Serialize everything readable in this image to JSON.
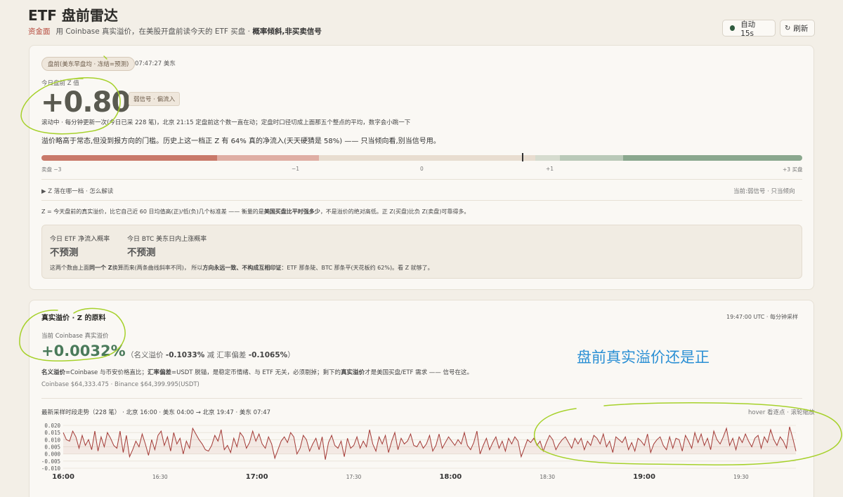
{
  "header": {
    "title": "ETF 盘前雷达",
    "tag": "资金面",
    "subtitle": "用 Coinbase 真实溢价，在美股开盘前读今天的 ETF 买盘 ·",
    "subtitle_bold": "概率倾斜,非买卖信号",
    "auto_label": "自动 15s",
    "refresh_label": "刷新"
  },
  "zcard": {
    "pill": "盘前(美东早盘均 · 冻结=预测)",
    "time": "07:47:27 美东",
    "label": "今日盘前 Z 值",
    "z_value": "+0.80",
    "signal": "弱信号 · 偏流入",
    "rolling_note": "滚动中 · 每分钟更新一次(今日已采 228 笔)，北京 21:15 定盘前这个数一直在动；定盘时口径切成上面那五个整点的平均，数字会小跳一下",
    "description": "溢价略高于常态,但没到报方向的门槛。历史上这一档正 Z 有 64% 真的净流入(天天硬猜是 58%) —— 只当倾向看,别当信号用。",
    "scale_ticks": [
      "卖盘 −3",
      "−1",
      "0",
      "+1",
      "+3 买盘"
    ],
    "marker_value": 0.8,
    "toggle_label": "▶  Z 落在哪一档 · 怎么解读",
    "current_label": "当前:弱信号 · 只当倾向",
    "explain_pre": "Z = 今天盘前的真实溢价，比它自己近 60 日均值高(正)/低(负)几个标准差 —— 衡量的是",
    "explain_bold": "美国买盘比平时强多少",
    "explain_post": "，不是溢价的绝对高低。正 Z(买盘)比负 Z(卖盘)可靠得多。",
    "etf_prob_label": "今日 ETF 净流入概率",
    "etf_prob_value": "不预测",
    "btc_prob_label": "今日 BTC 美东日内上涨概率",
    "btc_prob_value": "不预测",
    "prob_note_1": "这两个数由上面",
    "prob_note_b1": "同一个 Z",
    "prob_note_2": "换算而来(两条曲线斜率不同)， 所以",
    "prob_note_b2": "方向永远一致、不构成互相印证",
    "prob_note_3": "：ETF 那条陡、BTC 那条平(天花板约 62%)。看 Z 就够了。"
  },
  "premium": {
    "title": "真实溢价 · Z 的原料",
    "sample_time": "19:47:00 UTC · 每分钟采样",
    "current_label": "当前 Coinbase 真实溢价",
    "value": "+0.0032%",
    "nominal_pre": "（名义溢价",
    "nominal_value": "-0.1033%",
    "fx_pre": "减 汇率偏差",
    "fx_value": "-0.1065%",
    "close": "）",
    "def_b1": "名义溢价",
    "def_1": "=Coinbase 与币安价格直比；",
    "def_b2": "汇率偏差",
    "def_2": "=USDT 脱锚，是稳定币情绪、与 ETF 无关，必须剔掉；剩下的",
    "def_b3": "真实溢价",
    "def_3": "才是美国买盘/ETF 需求 —— 信号在这。",
    "prices": "Coinbase $64,333.475 · Binance $64,399.995(USDT)",
    "chart_title": "最新采样时段走势（228 笔） · 北京 16:00 · 美东 04:00 → 北京 19:47 · 美东 07:47",
    "chart_hint": "hover 看逐点 · 滚轮缩放"
  },
  "annotation": "盘前真实溢价还是正",
  "colors": {
    "sell": "#c9796a",
    "buy": "#8aa88e",
    "line": "#a33a36",
    "premium": "#4a7a5a"
  },
  "chart_data": {
    "type": "line",
    "title": "最新采样时段走势（228 笔）",
    "xlabel": "",
    "ylabel": "",
    "x_range": [
      "16:00",
      "19:47"
    ],
    "x_ticks": [
      "16:00",
      "16:30",
      "17:00",
      "17:30",
      "18:00",
      "18:30",
      "19:00",
      "19:30"
    ],
    "y_ticks": [
      "0.020",
      "0.015",
      "0.010",
      "0.005",
      "0.000",
      "-0.005",
      "-0.010"
    ],
    "ylim": [
      -0.01,
      0.02
    ],
    "grid": true,
    "series": [
      {
        "values": [
          0.015,
          0.01,
          0.009,
          0.016,
          0.012,
          0.004,
          0.013,
          0.006,
          0.01,
          0.003,
          0.016,
          0.002,
          0.012,
          0.005,
          0.015,
          0.011,
          0.006,
          0.004,
          0.016,
          0.001,
          0.013,
          -0.002,
          0.003,
          0.009,
          0.005,
          0.014,
          0.007,
          -0.001,
          0.01,
          0.003,
          0.013,
          0.016,
          0.006,
          0.012,
          0.002,
          0.015,
          0.007,
          0.011,
          0.0,
          0.009,
          0.004,
          0.018,
          0.014,
          0.01,
          0.007,
          0.003,
          0.002,
          0.006,
          0.013,
          0.009,
          0.017,
          0.003,
          0.006,
          0.001,
          0.011,
          0.005,
          0.015,
          0.012,
          0.004,
          0.008,
          0.016,
          0.009,
          0.014,
          0.007,
          0.004,
          0.012,
          0.007,
          -0.003,
          0.003,
          0.009,
          0.012,
          0.008,
          0.015,
          0.012,
          0.0,
          0.004,
          0.013,
          0.01,
          0.002,
          0.007,
          0.011,
          0.003,
          0.012,
          -0.004,
          0.008,
          0.013,
          0.006,
          0.004,
          0.009,
          -0.002,
          0.011,
          0.004,
          0.006,
          0.012,
          0.004,
          0.009,
          0.005,
          0.017,
          0.007,
          0.002,
          0.012,
          0.007,
          0.013,
          0.001,
          0.009,
          0.015,
          0.003,
          0.011,
          0.007,
          0.009,
          0.014,
          0.006,
          0.005,
          0.009,
          0.004,
          0.007,
          0.013,
          0.002,
          0.006,
          0.014,
          0.004,
          0.008,
          0.012,
          0.009,
          0.006,
          0.01,
          0.007,
          0.015,
          0.006,
          0.003,
          0.008,
          0.016,
          0.0,
          0.006,
          0.011,
          0.003,
          0.008,
          0.012,
          0.004,
          0.009,
          0.002,
          0.011,
          0.007,
          0.012,
          0.009,
          -0.002,
          0.004,
          0.01,
          0.008,
          0.011,
          0.006,
          0.009,
          0.002,
          0.008,
          0.013,
          0.01,
          0.003,
          0.007,
          0.01,
          0.012,
          0.008,
          0.004,
          0.011,
          0.007,
          0.011,
          0.003,
          0.009,
          0.006,
          0.013,
          0.011,
          0.007,
          0.014,
          0.005,
          0.009,
          0.001,
          0.012,
          0.01,
          0.008,
          0.012,
          0.003,
          0.008,
          0.002,
          0.011,
          0.009,
          0.006,
          0.014,
          0.001,
          0.007,
          0.01,
          0.012,
          0.006,
          0.003,
          0.012,
          0.004,
          0.011,
          0.01,
          0.002,
          0.013,
          0.009,
          0.004,
          0.015,
          0.008,
          0.014,
          0.006,
          0.011,
          0.003,
          0.016,
          0.01,
          0.007,
          0.012,
          0.018,
          0.006,
          0.011,
          0.003,
          0.012,
          0.008,
          0.014,
          0.009,
          0.005,
          0.011,
          0.013,
          0.004,
          0.012,
          0.008,
          0.017,
          0.01,
          0.006,
          0.012,
          0.009,
          0.004,
          0.019,
          0.011,
          0.002
        ]
      }
    ]
  }
}
